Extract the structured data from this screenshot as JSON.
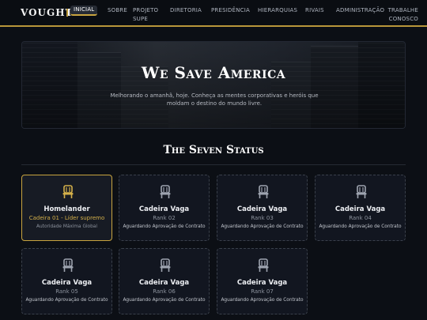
{
  "brand": "VOUGHT",
  "nav": [
    {
      "label": "INICIAL",
      "active": true
    },
    {
      "label": "SOBRE"
    },
    {
      "label": "PROJETO SUPE"
    },
    {
      "label": "DIRETORIA"
    },
    {
      "label": "PRESIDÊNCIA"
    },
    {
      "label": "HIERARQUIAS"
    },
    {
      "label": "RIVAIS"
    },
    {
      "label": "ADMINISTRAÇÃO"
    },
    {
      "label": "TRABALHE CONOSCO"
    }
  ],
  "hero": {
    "title": "We Save America",
    "subtitle": "Melhorando o amanhã, hoje. Conheça as mentes corporativas e heróis que moldam o destino do mundo livre."
  },
  "section": {
    "title": "The Seven Status"
  },
  "cards": [
    {
      "name": "Homelander",
      "rank": "Cadeira 01 - Líder supremo",
      "status": "Autoridade Máxima Global",
      "featured": true,
      "icon": "chair-icon"
    },
    {
      "name": "Cadeira Vaga",
      "rank": "Rank 02",
      "status": "Aguardando Aprovação de Contrato",
      "featured": false,
      "icon": "chair-icon"
    },
    {
      "name": "Cadeira Vaga",
      "rank": "Rank 03",
      "status": "Aguardando Aprovação de Contrato",
      "featured": false,
      "icon": "chair-icon"
    },
    {
      "name": "Cadeira Vaga",
      "rank": "Rank 04",
      "status": "Aguardando Aprovação de Contrato",
      "featured": false,
      "icon": "chair-icon"
    },
    {
      "name": "Cadeira Vaga",
      "rank": "Rank 05",
      "status": "Aguardando Aprovação de Contrato",
      "featured": false,
      "icon": "chair-icon"
    },
    {
      "name": "Cadeira Vaga",
      "rank": "Rank 06",
      "status": "Aguardando Aprovação de Contrato",
      "featured": false,
      "icon": "chair-icon"
    },
    {
      "name": "Cadeira Vaga",
      "rank": "Rank 07",
      "status": "Aguardando Aprovação de Contrato",
      "featured": false,
      "icon": "chair-icon"
    }
  ],
  "colors": {
    "accent": "#c9a43f",
    "background": "#0c0f15",
    "card": "#121620"
  }
}
